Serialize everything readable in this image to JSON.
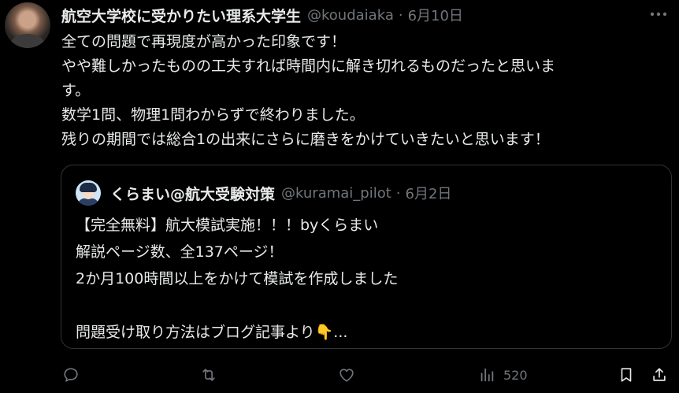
{
  "post": {
    "display_name": "航空大学校に受かりたい理系大学生",
    "handle": "@koudaiaka",
    "separator": "·",
    "date": "6月10日",
    "lines": [
      "全ての問題で再現度が高かった印象です！",
      "やや難しかったものの工夫すれば時間内に解き切れるものだったと思いま",
      "す。",
      "数学1問、物理1問わからずで終わりました。",
      "残りの期間では総合1の出来にさらに磨きをかけていきたいと思います！"
    ]
  },
  "quote": {
    "display_name": "くらまい@航大受験対策",
    "handle": "@kuramai_pilot",
    "separator": "·",
    "date": "6月2日",
    "lines": [
      "【完全無料】航大模試実施！！！byくらまい",
      "解説ページ数、全137ページ！",
      "2か月100時間以上をかけて模試を作成しました",
      "",
      "問題受け取り方法はブログ記事より👇..."
    ]
  },
  "actions": {
    "views": "520"
  },
  "colors": {
    "background": "#000000",
    "text": "#e7e9ea",
    "secondary": "#71767b",
    "border": "#2f3336"
  },
  "icons": [
    "more-icon",
    "reply-icon",
    "repost-icon",
    "like-icon",
    "views-icon",
    "bookmark-icon",
    "share-icon"
  ]
}
